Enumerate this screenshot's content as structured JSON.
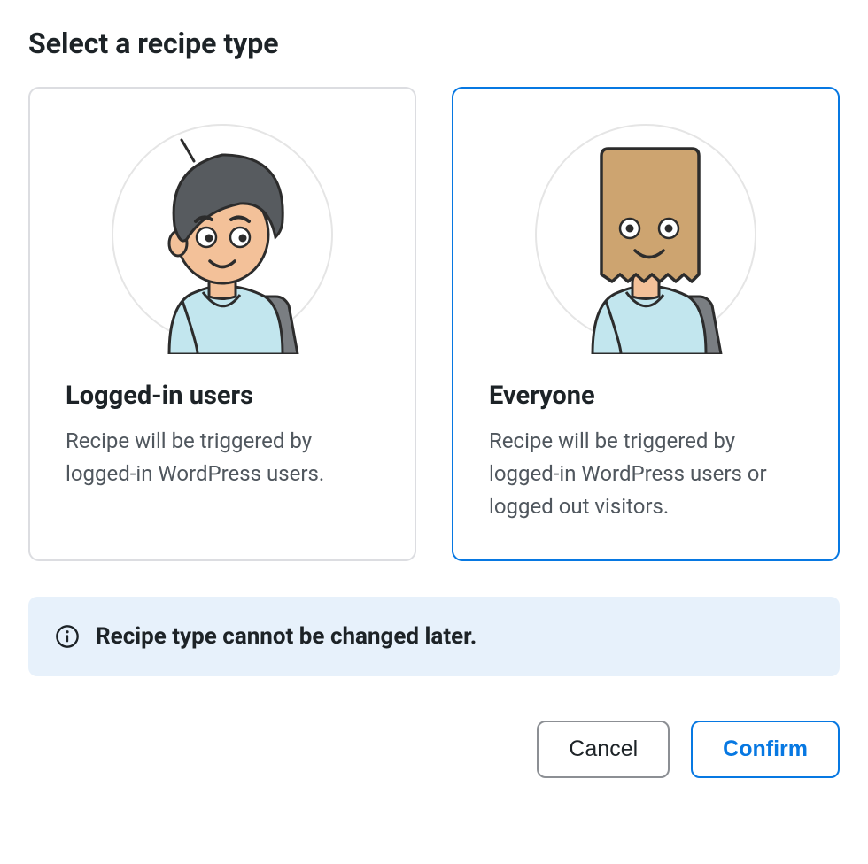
{
  "title": "Select a recipe type",
  "options": [
    {
      "id": "logged-in",
      "title": "Logged-in users",
      "description": "Recipe will be triggered by logged-in WordPress users.",
      "selected": false,
      "illustration": "user-avatar"
    },
    {
      "id": "everyone",
      "title": "Everyone",
      "description": "Recipe will be triggered by logged-in WordPress users or logged out visitors.",
      "selected": true,
      "illustration": "anonymous-bag-avatar"
    }
  ],
  "notice": {
    "icon": "info-icon",
    "text": "Recipe type cannot be changed later."
  },
  "actions": {
    "cancel_label": "Cancel",
    "confirm_label": "Confirm"
  }
}
